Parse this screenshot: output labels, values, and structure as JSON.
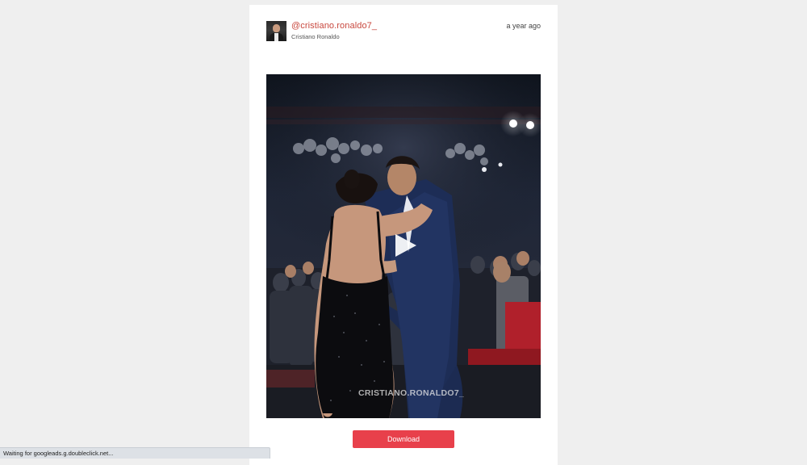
{
  "post": {
    "username": "@cristiano.ronaldo7_",
    "full_name": "Cristiano Ronaldo",
    "time_ago": "a year ago",
    "video_watermark": "CRISTIANO.RONALDO7_",
    "download_label": "Download"
  },
  "status_bar": {
    "text": "Waiting for googleads.g.doubleclick.net..."
  },
  "colors": {
    "page_background": "#efefef",
    "card_background": "#ffffff",
    "username_link": "#c8473d",
    "download_button": "#e8404b"
  },
  "icons": {
    "play": "play-icon"
  }
}
